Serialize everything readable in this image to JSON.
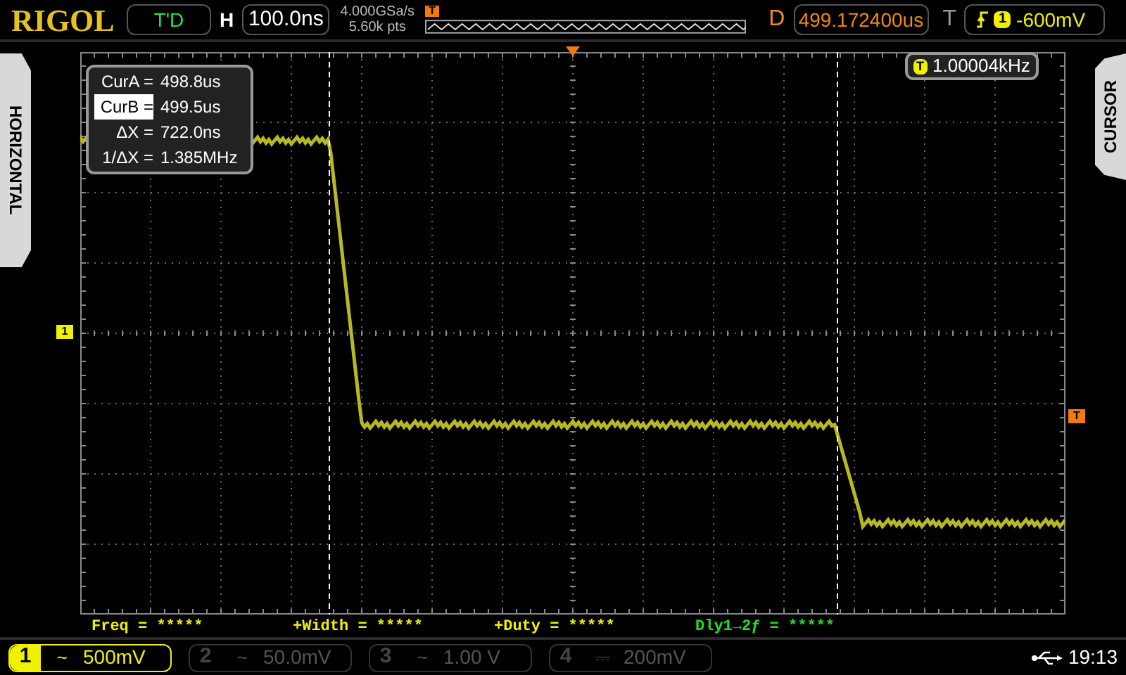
{
  "logo": "RIGOL",
  "top_bar": {
    "run_status": "T'D",
    "timebase_label": "H",
    "timebase": "100.0ns",
    "sample_rate": "4.000GSa/s",
    "memory_depth": "5.60k pts",
    "delay_label": "D",
    "delay": "499.172400us",
    "trigger_label": "T",
    "trigger_source": "1",
    "trigger_level": "-600mV"
  },
  "side_tabs": {
    "left": "HORIZONTAL",
    "right": "CURSOR"
  },
  "markers": {
    "trigger_position": "T",
    "channel_1": "1",
    "trigger_level": "T"
  },
  "cursor_readout": [
    {
      "label": "CurA =",
      "value": "498.8us",
      "selected": false
    },
    {
      "label": "CurB =",
      "value": "499.5us",
      "selected": true
    },
    {
      "label": "ΔX =",
      "value": "722.0ns",
      "selected": false
    },
    {
      "label": "1/ΔX =",
      "value": "1.385MHz",
      "selected": false
    }
  ],
  "frequency_counter": {
    "badge": "T",
    "value": "1.00004kHz"
  },
  "measurements": [
    {
      "text": "Freq = *****",
      "color": "#f0f000"
    },
    {
      "text": "+Width = *****",
      "color": "#f0f000"
    },
    {
      "text": "+Duty = *****",
      "color": "#f0f000"
    },
    {
      "text": "Dly1→2ƒ = *****",
      "color": "#20e020"
    }
  ],
  "channels": [
    {
      "number": "1",
      "coupling": "~",
      "scale": "500mV",
      "on": true
    },
    {
      "number": "2",
      "coupling": "~",
      "scale": "50.0mV",
      "on": false
    },
    {
      "number": "3",
      "coupling": "~",
      "scale": "1.00 V",
      "on": false
    },
    {
      "number": "4",
      "coupling": "⎓",
      "scale": "200mV",
      "on": false
    }
  ],
  "clock": "19:13"
}
